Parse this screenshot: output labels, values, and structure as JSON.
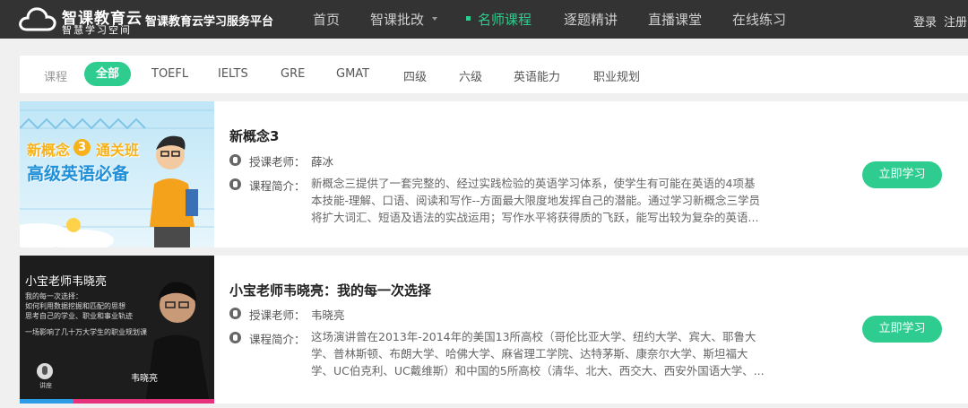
{
  "header": {
    "brand": "智课教育云",
    "brand_sub": "智慧学习空间",
    "platform": "智课教育云学习服务平台",
    "nav": [
      "首页",
      "智课批改",
      "名师课程",
      "逐题精讲",
      "直播课堂",
      "在线练习"
    ],
    "active_nav": "名师课程",
    "login": "登录",
    "register": "注册"
  },
  "filter": {
    "label": "课程",
    "chips": [
      "全部",
      "TOEFL",
      "IELTS",
      "GRE",
      "GMAT",
      "四级",
      "六级",
      "英语能力",
      "职业规划"
    ],
    "active": "全部"
  },
  "courses": [
    {
      "title": "新概念3",
      "teacher_label": "授课老师：",
      "teacher": "薛冰",
      "intro_label": "课程简介：",
      "intro_lines": [
        "新概念三提供了一套完整的、经过实践检验的英语学习体系，使学生有可能在英语的4项基",
        "本技能-理解、口语、阅读和写作--方面最大限度地发挥自己的潜能。通过学习新概念三学员",
        "将扩大词汇、短语及语法的实战运用；写作水平将获得质的飞跃，能写出较为复杂的英语..."
      ],
      "button": "立即学习",
      "thumb": {
        "line1": "新概念",
        "circle": "3",
        "line1b": "通关班",
        "line2": "高级英语必备"
      }
    },
    {
      "title": "小宝老师韦晓亮：我的每一次选择",
      "teacher_label": "授课老师：",
      "teacher": "韦晓亮",
      "intro_label": "课程简介：",
      "intro_lines": [
        "这场演讲曾在2013年-2014年的美国13所高校（哥伦比亚大学、纽约大学、宾大、耶鲁大",
        "学、普林斯顿、布朗大学、哈佛大学、麻省理工学院、达特茅斯、康奈尔大学、斯坦福大",
        "学、UC伯克利、UC戴维斯）和中国的5所高校（清华、北大、西交大、西安外国语大学、..."
      ],
      "button": "立即学习",
      "thumb": {
        "title": "小宝老师韦晓亮",
        "lines": [
          "我的每一次选择：",
          "如何利用数据挖掘和匹配的思想",
          "思考自己的学业、职业和事业轨迹"
        ],
        "tagline": "一场影响了几十万大学生的职业规划课",
        "name": "韦晓亮",
        "mic_label": "讲座"
      }
    }
  ],
  "colors": {
    "topbar": "#333333",
    "accent": "#2ecc8f",
    "page_bg": "#f0f0f0"
  }
}
